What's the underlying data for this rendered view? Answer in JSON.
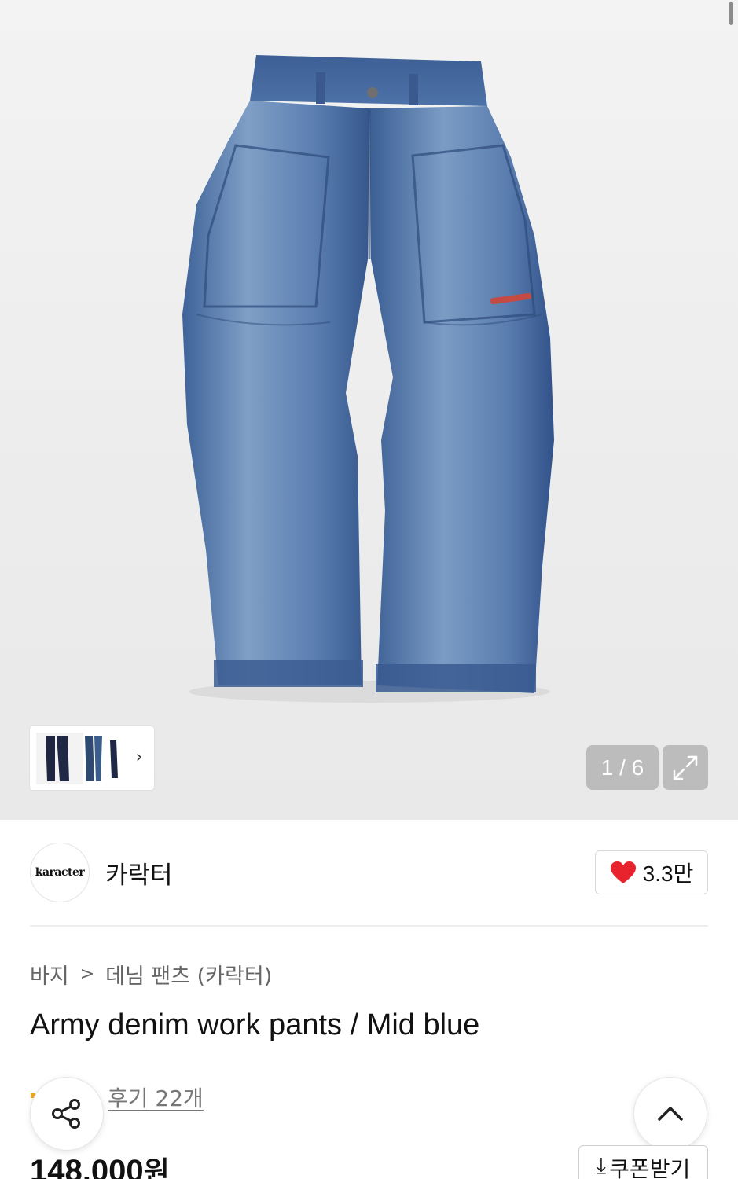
{
  "gallery": {
    "counter": "1 / 6",
    "thumbnail_next": "›"
  },
  "brand": {
    "logo_text": "karacter",
    "name": "카락터",
    "likes": "3.3만"
  },
  "breadcrumb": {
    "category": "바지",
    "separator": ">",
    "subcategory": "데님 팬츠 (카락터)"
  },
  "product": {
    "title": "Army denim work pants / Mid blue",
    "reviews": "후기 22개",
    "price": "148,000",
    "price_unit": "원"
  },
  "actions": {
    "coupon_icon": "⤓",
    "coupon_label": "쿠폰받기"
  },
  "icons": {
    "like": "heart-icon",
    "share": "share-icon",
    "scroll_top": "chevron-up-icon",
    "expand": "expand-icon"
  },
  "colors": {
    "heart": "#e8232e",
    "star": "#f4a51c",
    "denim": "#4a6fa5"
  }
}
